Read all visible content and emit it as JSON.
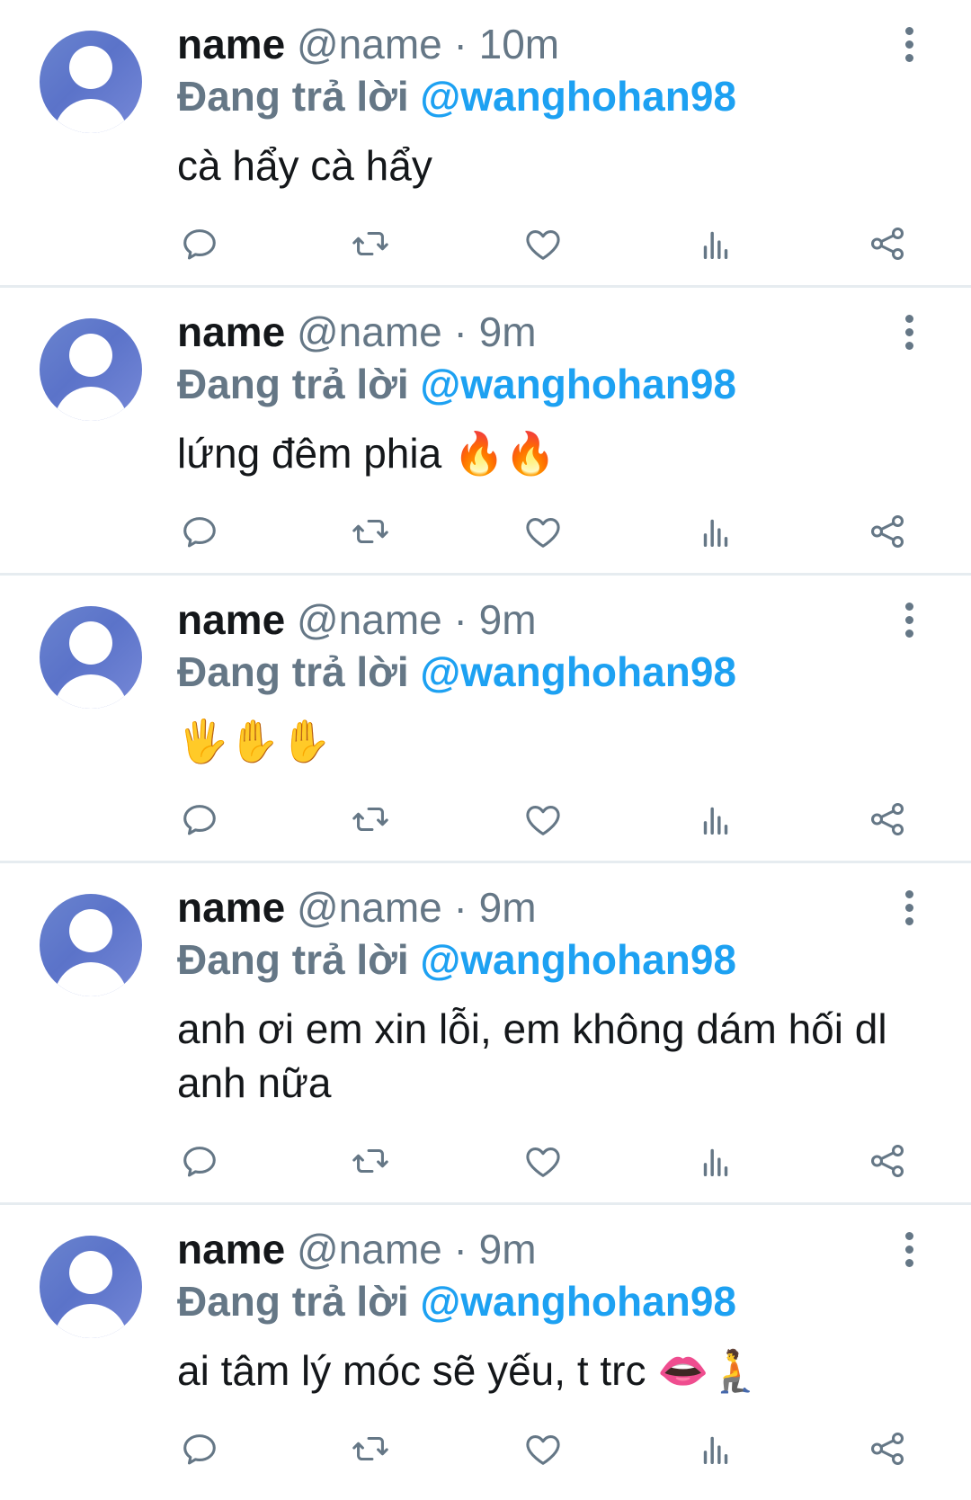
{
  "colors": {
    "name": "#14171a",
    "muted": "#657786",
    "mention": "#1da1f2",
    "divider": "#e6ecf0",
    "avatar": "#6a84cf"
  },
  "icons": {
    "avatar": "default-avatar-icon",
    "menu": "more-vertical-icon",
    "reply": "reply-icon",
    "retweet": "retweet-icon",
    "like": "heart-icon",
    "stats": "analytics-icon",
    "share": "share-icon"
  },
  "tweets": [
    {
      "name": "name",
      "handle": "@name",
      "separator": "·",
      "time": "10m",
      "reply_prefix": "Đang trả lời",
      "reply_to": "@wanghohan98",
      "text": "cà hẩy cà hẩy"
    },
    {
      "name": "name",
      "handle": "@name",
      "separator": "·",
      "time": "9m",
      "reply_prefix": "Đang trả lời",
      "reply_to": "@wanghohan98",
      "text": "lứng đêm phia 🔥🔥"
    },
    {
      "name": "name",
      "handle": "@name",
      "separator": "·",
      "time": "9m",
      "reply_prefix": "Đang trả lời",
      "reply_to": "@wanghohan98",
      "text": "🖐✋✋"
    },
    {
      "name": "name",
      "handle": "@name",
      "separator": "·",
      "time": "9m",
      "reply_prefix": "Đang trả lời",
      "reply_to": "@wanghohan98",
      "text": "anh ơi em xin lỗi, em không dám hối dl anh nữa"
    },
    {
      "name": "name",
      "handle": "@name",
      "separator": "·",
      "time": "9m",
      "reply_prefix": "Đang trả lời",
      "reply_to": "@wanghohan98",
      "text": "ai tâm lý móc sẽ yếu, t trc 👄🧎"
    }
  ]
}
